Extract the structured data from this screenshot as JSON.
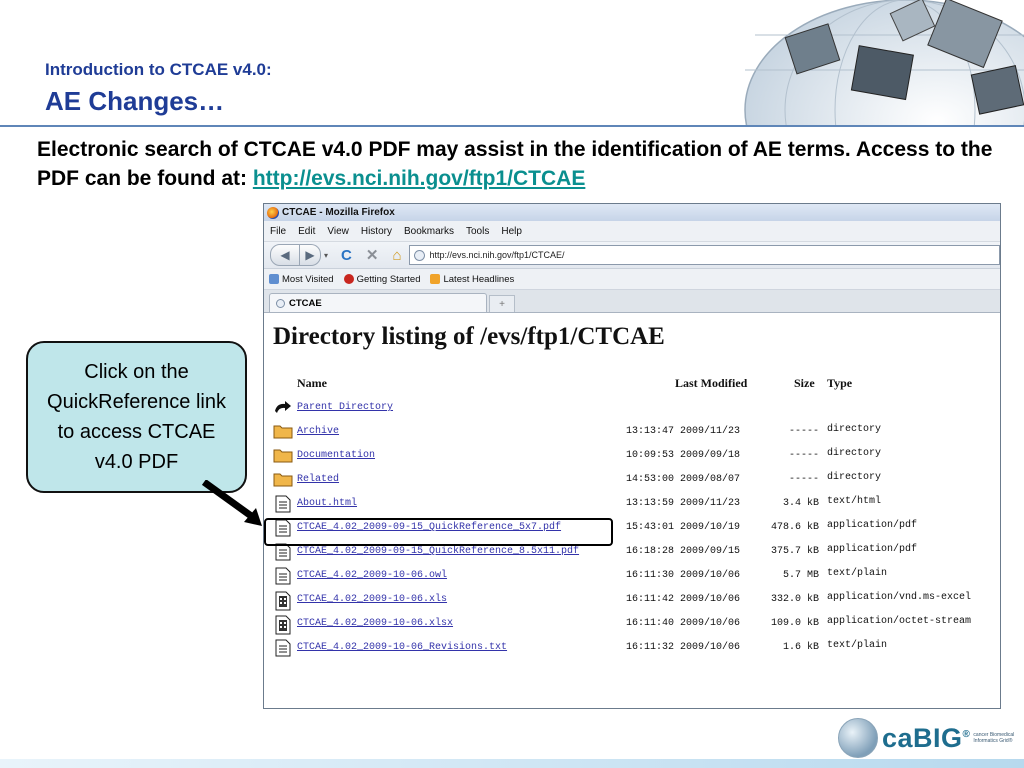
{
  "slide": {
    "subtitle": "Introduction to CTCAE v4.0:",
    "title": "AE Changes…",
    "lead_text": "Electronic search of CTCAE v4.0 PDF may assist in the identification of AE terms.  Access to the PDF can be found at: ",
    "lead_link": "http://evs.nci.nih.gov/ftp1/CTCAE",
    "callout_text": "Click on the QuickReference link to access CTCAE v4.0 PDF",
    "logo_word": "caBIG",
    "logo_mark": "®",
    "logo_tag": "cancer Biomedical Informatics Grid®"
  },
  "browser": {
    "window_title": "CTCAE - Mozilla Firefox",
    "menu": [
      "File",
      "Edit",
      "View",
      "History",
      "Bookmarks",
      "Tools",
      "Help"
    ],
    "url": "http://evs.nci.nih.gov/ftp1/CTCAE/",
    "bookmarks": [
      "Most Visited",
      "Getting Started",
      "Latest Headlines"
    ],
    "tab_title": "CTCAE",
    "new_tab_symbol": "+",
    "nav": {
      "back_symbol": "◀",
      "forward_symbol": "▶",
      "history_drop_symbol": "▾",
      "reload_symbol": "C",
      "stop_symbol": "✕",
      "home_symbol": "⌂"
    }
  },
  "listing": {
    "heading": "Directory listing of /evs/ftp1/CTCAE",
    "columns": {
      "name": "Name",
      "modified": "Last Modified",
      "size": "Size",
      "type": "Type"
    },
    "parent": "Parent Directory",
    "rows": [
      {
        "name": "Archive",
        "modified": "13:13:47 2009/11/23",
        "size": "-----",
        "type": "directory",
        "icon": "folder-icon"
      },
      {
        "name": "Documentation",
        "modified": "10:09:53 2009/09/18",
        "size": "-----",
        "type": "directory",
        "icon": "folder-icon"
      },
      {
        "name": "Related",
        "modified": "14:53:00 2009/08/07",
        "size": "-----",
        "type": "directory",
        "icon": "folder-icon"
      },
      {
        "name": "About.html",
        "modified": "13:13:59 2009/11/23",
        "size": "3.4 kB",
        "type": "text/html",
        "icon": "document-icon"
      },
      {
        "name": "CTCAE_4.02_2009-09-15_QuickReference_5x7.pdf",
        "modified": "15:43:01 2009/10/19",
        "size": "478.6 kB",
        "type": "application/pdf",
        "icon": "document-icon"
      },
      {
        "name": "CTCAE_4.02_2009-09-15_QuickReference_8.5x11.pdf",
        "modified": "16:18:28 2009/09/15",
        "size": "375.7 kB",
        "type": "application/pdf",
        "icon": "document-icon"
      },
      {
        "name": "CTCAE_4.02_2009-10-06.owl",
        "modified": "16:11:30 2009/10/06",
        "size": "5.7 MB",
        "type": "text/plain",
        "icon": "document-icon"
      },
      {
        "name": "CTCAE_4.02_2009-10-06.xls",
        "modified": "16:11:42 2009/10/06",
        "size": "332.0 kB",
        "type": "application/vnd.ms-excel",
        "icon": "binary-icon"
      },
      {
        "name": "CTCAE_4.02_2009-10-06.xlsx",
        "modified": "16:11:40 2009/10/06",
        "size": "109.0 kB",
        "type": "application/octet-stream",
        "icon": "binary-icon"
      },
      {
        "name": "CTCAE_4.02_2009-10-06_Revisions.txt",
        "modified": "16:11:32 2009/10/06",
        "size": "1.6 kB",
        "type": "text/plain",
        "icon": "document-icon"
      }
    ]
  },
  "colors": {
    "title_blue": "#1f3c96",
    "link_teal": "#0a8f8f",
    "callout_fill": "#bfe6ea",
    "listing_link": "#3333aa"
  }
}
